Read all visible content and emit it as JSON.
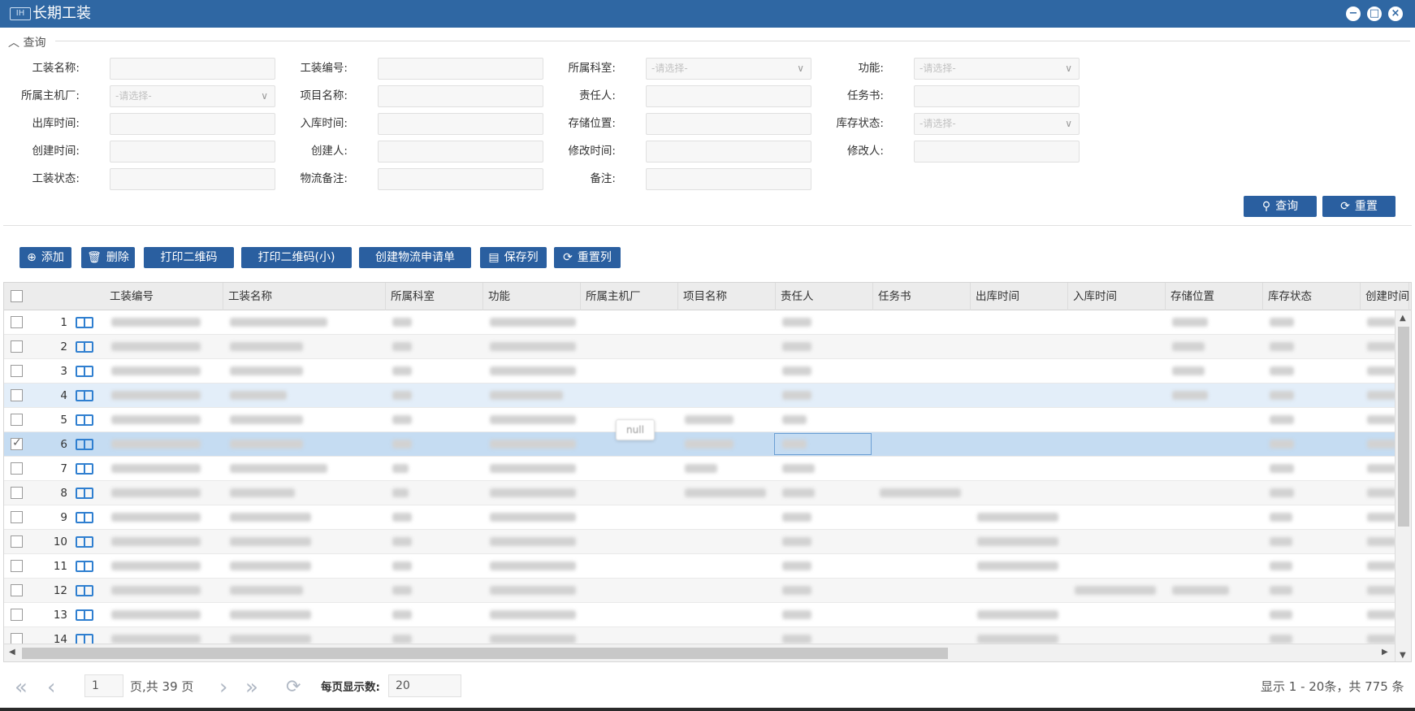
{
  "window": {
    "title": "长期工装",
    "logo_text": "IH"
  },
  "query": {
    "legend": "查询",
    "fields": [
      {
        "label": "工装名称:",
        "value": "",
        "dropdown": false
      },
      {
        "label": "工装编号:",
        "value": "",
        "dropdown": false
      },
      {
        "label": "所属科室:",
        "value": "-请选择-",
        "dropdown": true
      },
      {
        "label": "功能:",
        "value": "-请选择-",
        "dropdown": true
      },
      {
        "label": "所属主机厂:",
        "value": "-请选择-",
        "dropdown": true
      },
      {
        "label": "项目名称:",
        "value": "",
        "dropdown": false
      },
      {
        "label": "责任人:",
        "value": "",
        "dropdown": false
      },
      {
        "label": "任务书:",
        "value": "",
        "dropdown": false
      },
      {
        "label": "出库时间:",
        "value": "",
        "dropdown": false
      },
      {
        "label": "入库时间:",
        "value": "",
        "dropdown": false
      },
      {
        "label": "存储位置:",
        "value": "",
        "dropdown": false
      },
      {
        "label": "库存状态:",
        "value": "-请选择-",
        "dropdown": true
      },
      {
        "label": "创建时间:",
        "value": "",
        "dropdown": false
      },
      {
        "label": "创建人:",
        "value": "",
        "dropdown": false
      },
      {
        "label": "修改时间:",
        "value": "",
        "dropdown": false
      },
      {
        "label": "修改人:",
        "value": "",
        "dropdown": false
      },
      {
        "label": "工装状态:",
        "value": "",
        "dropdown": false
      },
      {
        "label": "物流备注:",
        "value": "",
        "dropdown": false
      },
      {
        "label": "备注:",
        "value": "",
        "dropdown": false
      }
    ],
    "search_label": "查询",
    "reset_label": "重置"
  },
  "toolbar": {
    "add": "添加",
    "delete": "删除",
    "print_qr": "打印二维码",
    "print_qr_small": "打印二维码(小)",
    "create_logistics": "创建物流申请单",
    "save_columns": "保存列",
    "reset_columns": "重置列"
  },
  "grid": {
    "columns": [
      "工装编号",
      "工装名称",
      "所属科室",
      "功能",
      "所属主机厂",
      "项目名称",
      "责任人",
      "任务书",
      "出库时间",
      "入库时间",
      "存储位置",
      "库存状态",
      "创建时间"
    ],
    "row_numbers": [
      "1",
      "2",
      "3",
      "4",
      "5",
      "6",
      "7",
      "8",
      "9",
      "10",
      "11",
      "12",
      "13",
      "14"
    ],
    "tooltip": "null"
  },
  "pager": {
    "page": "1",
    "page_total": "页,共 39 页",
    "per_page_label": "每页显示数:",
    "per_page": "20",
    "summary": "显示 1 - 20条，共 775 条"
  },
  "colors": {
    "title_bar": "#2f67a3",
    "button": "#2a5fa0",
    "selected_row": "#c5dcf2",
    "hover_row": "#e3eef9"
  }
}
